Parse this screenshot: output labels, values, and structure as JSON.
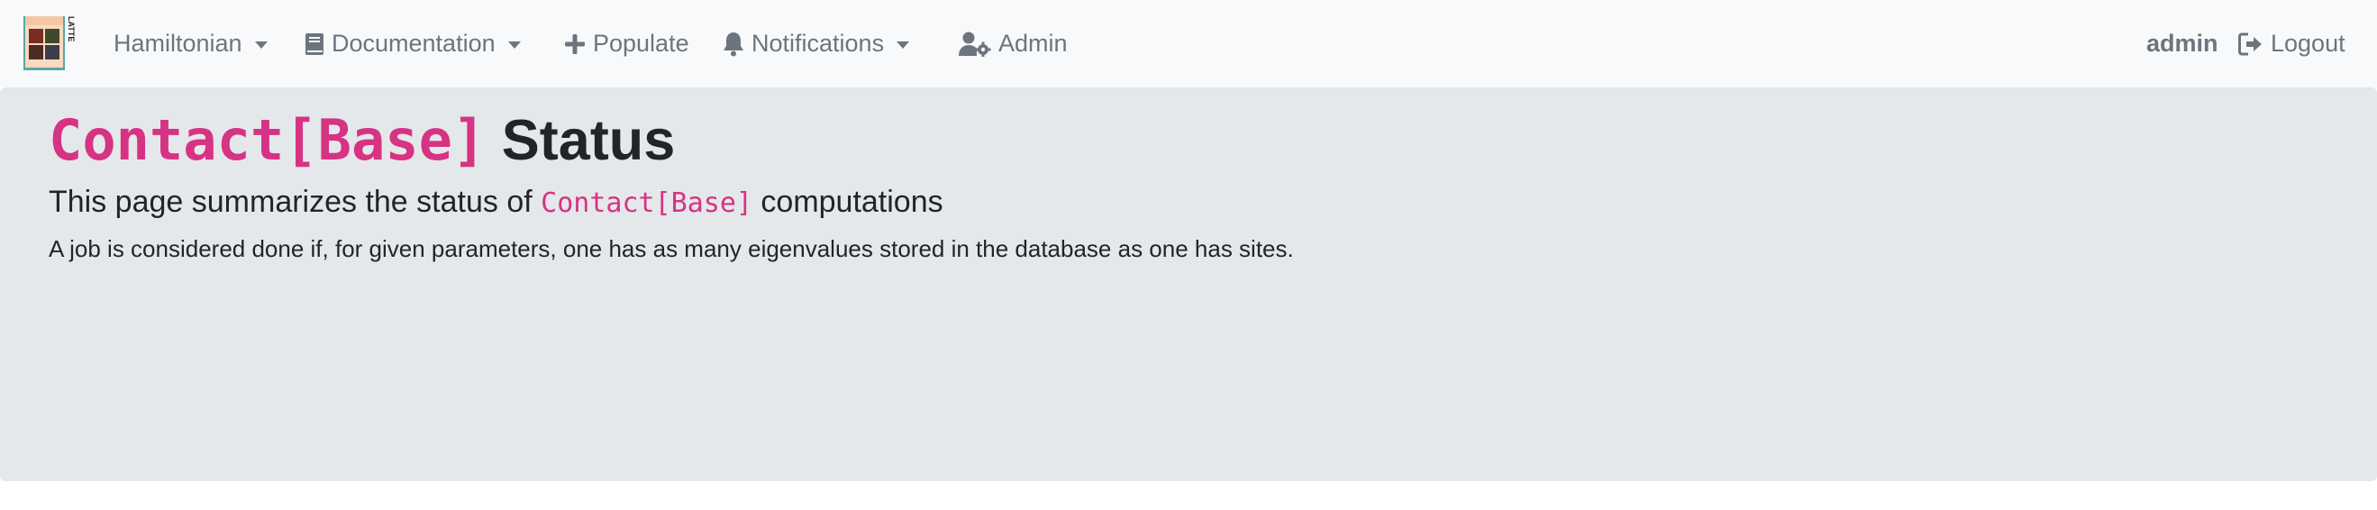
{
  "navbar": {
    "brand": {
      "logo_text": "LATTE"
    },
    "items": [
      {
        "label": "Hamiltonian",
        "icon": "none",
        "dropdown": true
      },
      {
        "label": "Documentation",
        "icon": "book-icon",
        "dropdown": true
      },
      {
        "label": "Populate",
        "icon": "plus-icon",
        "dropdown": false
      },
      {
        "label": "Notifications",
        "icon": "bell-icon",
        "dropdown": true
      },
      {
        "label": "Admin",
        "icon": "user-cog-icon",
        "dropdown": false
      }
    ],
    "user": {
      "name": "admin"
    },
    "logout": {
      "label": "Logout",
      "icon": "sign-out-icon"
    }
  },
  "main": {
    "title_code": "Contact[Base]",
    "title_text": "Status",
    "lead_prefix": "This page summarizes the status of",
    "lead_code": "Contact[Base]",
    "lead_suffix": "computations",
    "description": "A job is considered done if, for given parameters, one has as many eigenvalues stored in the database as one has sites."
  },
  "colors": {
    "navbar_bg": "#f8f9fa",
    "nav_text": "#6c757d",
    "jumbotron_bg": "#e5e8eb",
    "code_pink": "#d63384",
    "body_text": "#212529"
  }
}
